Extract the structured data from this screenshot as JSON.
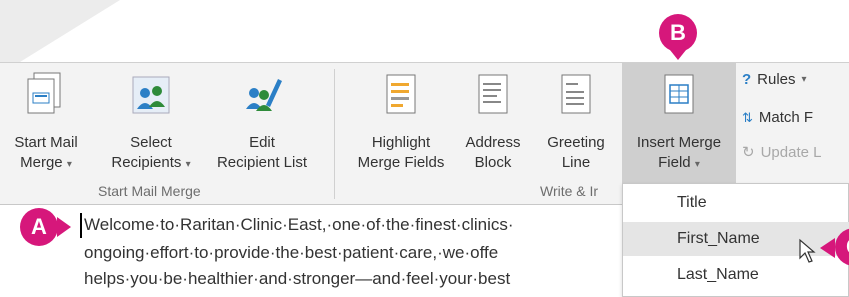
{
  "colors": {
    "callout": "#d6177b",
    "ribbon_bg": "#f3f3f3",
    "highlight": "#cfcfcf"
  },
  "callouts": {
    "a": "A",
    "b": "B",
    "c": "C"
  },
  "ribbon": {
    "start_mail_merge": {
      "line1": "Start Mail",
      "line2": "Merge",
      "icon": "mail-merge-document-icon"
    },
    "select_recipients": {
      "line1": "Select",
      "line2": "Recipients",
      "icon": "recipients-people-icon"
    },
    "edit_recipient_list": {
      "line1": "Edit",
      "line2": "Recipient List",
      "icon": "edit-recipients-icon"
    },
    "highlight_merge_fields": {
      "line1": "Highlight",
      "line2": "Merge Fields",
      "icon": "highlight-fields-icon"
    },
    "address_block": {
      "line1": "Address",
      "line2": "Block",
      "icon": "address-block-icon"
    },
    "greeting_line": {
      "line1": "Greeting",
      "line2": "Line",
      "icon": "greeting-line-icon"
    },
    "insert_merge_field": {
      "line1": "Insert Merge",
      "line2": "Field",
      "icon": "insert-field-icon"
    },
    "rules": "Rules",
    "match_fields": "Match F",
    "update_labels": "Update L",
    "groups": {
      "start_mail_merge": "Start Mail Merge",
      "write_insert": "Write & Ir"
    }
  },
  "menu": {
    "items": [
      "Title",
      "First_Name",
      "Last_Name"
    ],
    "highlighted": "First_Name"
  },
  "document": {
    "lines": [
      "Welcome·to·Raritan·Clinic·East,·one·of·the·finest·clinics·",
      "ongoing·effort·to·provide·the·best·patient·care,·we·offe",
      "helps·you·be·healthier·and·stronger—and·feel·your·best"
    ]
  }
}
